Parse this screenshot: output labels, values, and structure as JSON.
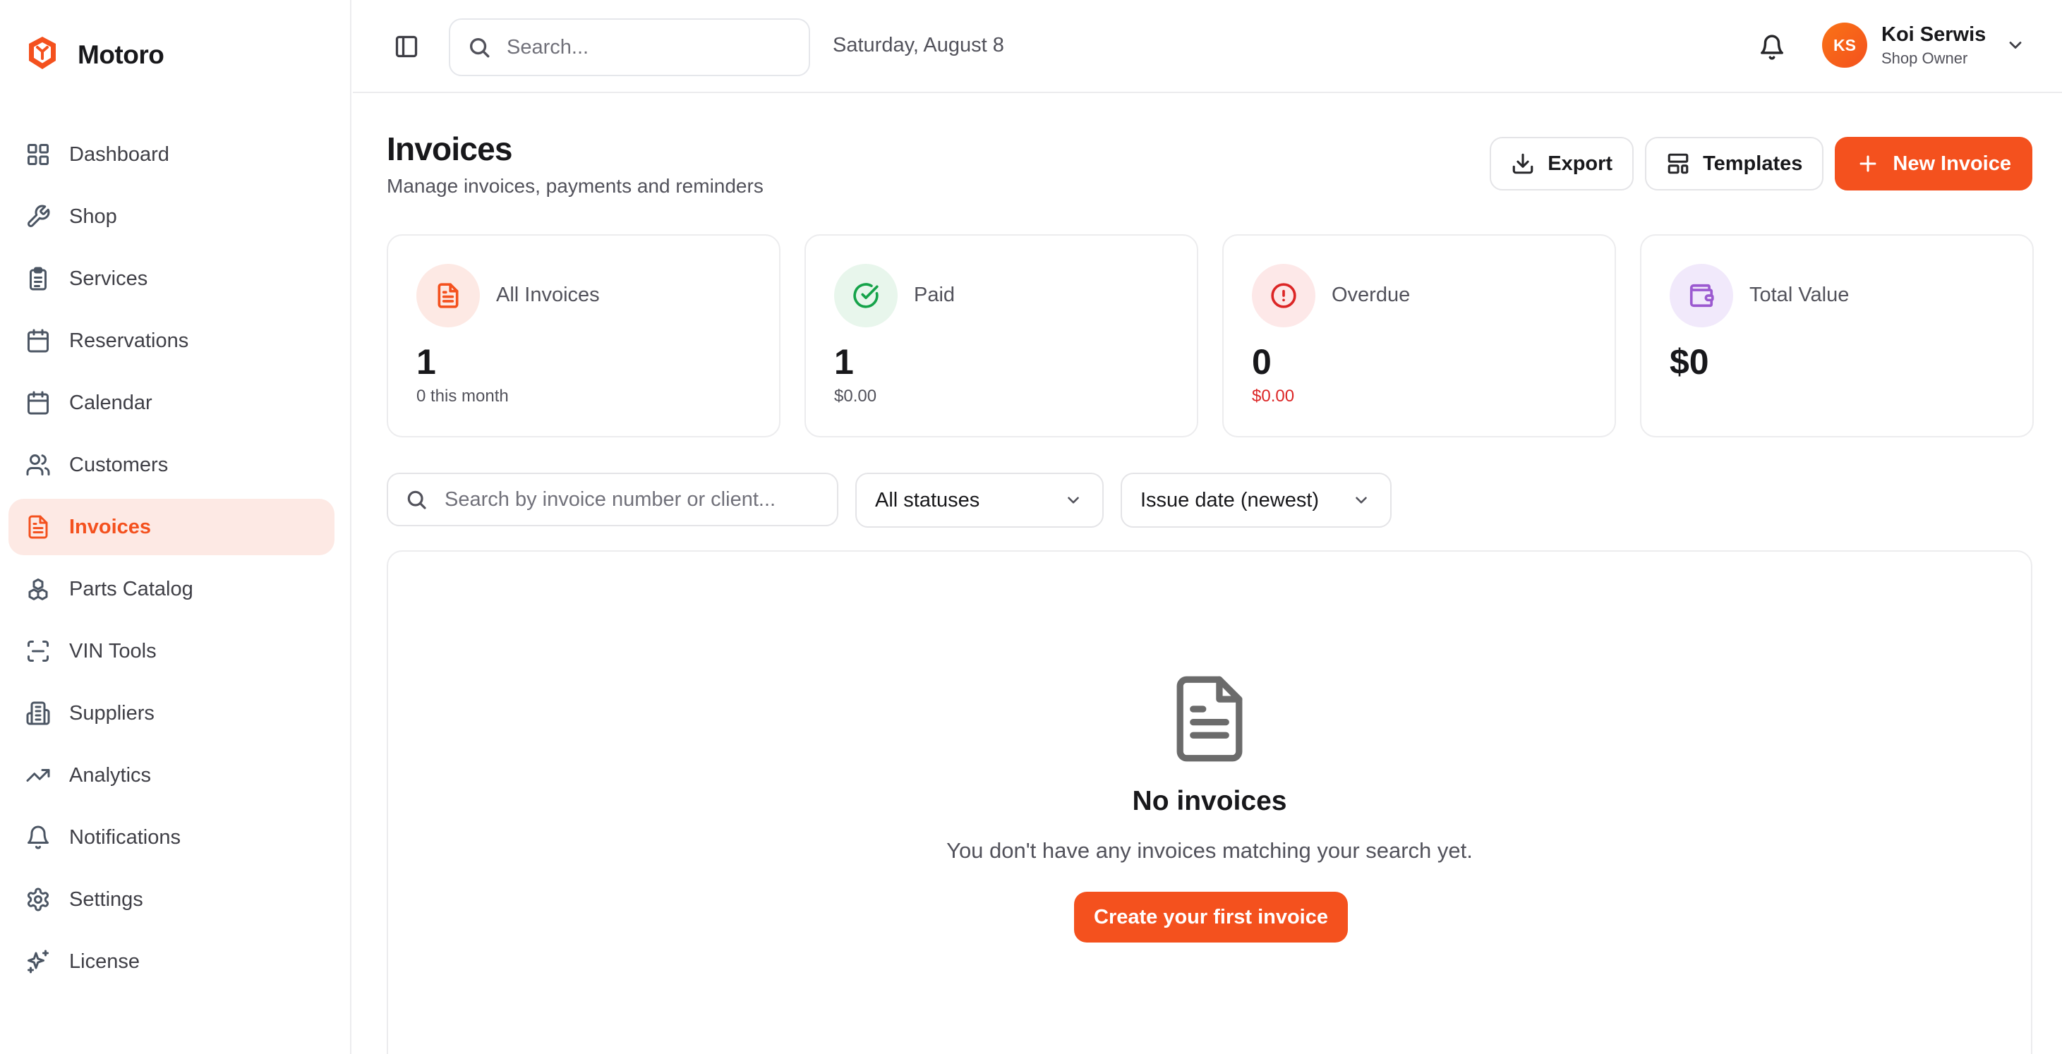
{
  "brand": {
    "name": "Motoro",
    "accent": "#f4511e"
  },
  "sidebar": {
    "items": [
      {
        "label": "Dashboard",
        "icon": "grid-icon"
      },
      {
        "label": "Shop",
        "icon": "wrench-icon"
      },
      {
        "label": "Services",
        "icon": "clipboard-icon"
      },
      {
        "label": "Reservations",
        "icon": "calendar-icon"
      },
      {
        "label": "Calendar",
        "icon": "calendar-icon"
      },
      {
        "label": "Customers",
        "icon": "users-icon"
      },
      {
        "label": "Invoices",
        "icon": "file-text-icon",
        "active": true
      },
      {
        "label": "Parts Catalog",
        "icon": "boxes-icon"
      },
      {
        "label": "VIN Tools",
        "icon": "scan-icon"
      },
      {
        "label": "Suppliers",
        "icon": "building-icon"
      },
      {
        "label": "Analytics",
        "icon": "trending-up-icon"
      },
      {
        "label": "Notifications",
        "icon": "bell-icon"
      },
      {
        "label": "Settings",
        "icon": "gear-icon"
      },
      {
        "label": "License",
        "icon": "sparkles-icon"
      }
    ]
  },
  "header": {
    "search_placeholder": "Search...",
    "date": "Saturday, August 8",
    "user": {
      "initials": "KS",
      "name": "Koi Serwis",
      "role": "Shop Owner"
    }
  },
  "page": {
    "title": "Invoices",
    "subtitle": "Manage invoices, payments and reminders",
    "actions": {
      "export": "Export",
      "templates": "Templates",
      "new_invoice": "New Invoice"
    }
  },
  "stats": [
    {
      "title": "All Invoices",
      "value": "1",
      "sub": "0 this month",
      "icon": "file-text-icon",
      "color": "#f4511e",
      "bg": "#fde9e4"
    },
    {
      "title": "Paid",
      "value": "1",
      "sub": "$0.00",
      "icon": "check-circle-icon",
      "color": "#16a34a",
      "bg": "#e8f6ec"
    },
    {
      "title": "Overdue",
      "value": "0",
      "sub": "$0.00",
      "icon": "alert-circle-icon",
      "color": "#dc2626",
      "bg": "#fde8e8"
    },
    {
      "title": "Total Value",
      "value": "$0",
      "sub": "",
      "icon": "wallet-icon",
      "color": "#9b59d0",
      "bg": "#f1e9fb"
    }
  ],
  "filters": {
    "search_placeholder": "Search by invoice number or client...",
    "status": "All statuses",
    "sort": "Issue date (newest)"
  },
  "empty": {
    "title": "No invoices",
    "text": "You don't have any invoices matching your search yet.",
    "cta": "Create your first invoice"
  }
}
